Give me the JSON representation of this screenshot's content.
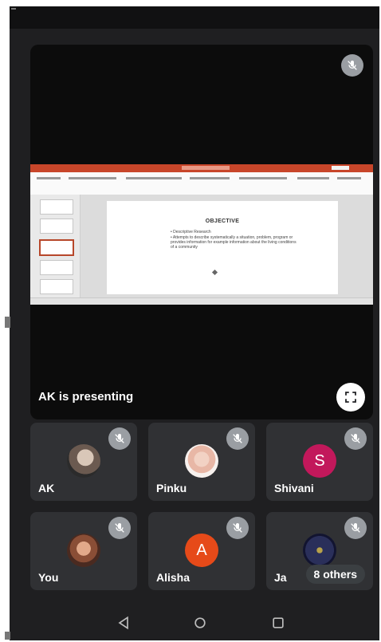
{
  "meeting": {
    "presenter_label": "AK is presenting",
    "slide": {
      "title": "OBJECTIVE",
      "bullets": [
        "Descriptive Research",
        "Attempts to describe systematically a situation, problem, program or provides information for example information about the living conditions of a community"
      ]
    }
  },
  "participants": [
    {
      "name": "AK",
      "avatar": "photo",
      "mic": "muted"
    },
    {
      "name": "Pinku",
      "avatar": "photo",
      "mic": "muted"
    },
    {
      "name": "Shivani",
      "avatar": "S",
      "avatar_color": "#c2185b",
      "mic": "muted"
    },
    {
      "name": "You",
      "avatar": "photo",
      "mic": "muted"
    },
    {
      "name": "Alisha",
      "avatar": "A",
      "avatar_color": "#e64a19",
      "mic": "muted"
    },
    {
      "name": "Ja",
      "avatar": "photo",
      "mic": "muted"
    }
  ],
  "others_chip": "8 others",
  "icons": {
    "mic": "mic-off-icon",
    "fullscreen": "fullscreen-icon",
    "nav": [
      "back-icon",
      "home-icon",
      "recents-icon"
    ]
  },
  "colors": {
    "background": "#1f1f21",
    "tile": "#303134",
    "ribbon": "#c8462a"
  }
}
